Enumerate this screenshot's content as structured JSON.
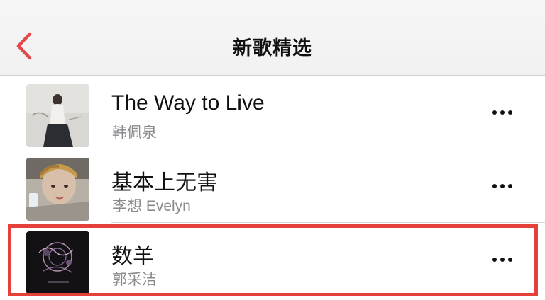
{
  "nav": {
    "back_icon": "chevron-left-icon",
    "title": "新歌精选",
    "accent_color": "#e0484a"
  },
  "songs": [
    {
      "title": "The Way to Live",
      "artist": "韩佩泉",
      "more_icon": "ellipsis-icon"
    },
    {
      "title": "基本上无害",
      "artist": "李想 Evelyn",
      "more_icon": "ellipsis-icon"
    },
    {
      "title": "数羊",
      "artist": "郭采洁",
      "more_icon": "ellipsis-icon"
    }
  ],
  "highlight": {
    "color": "#e5413a",
    "target": "songs.2"
  }
}
